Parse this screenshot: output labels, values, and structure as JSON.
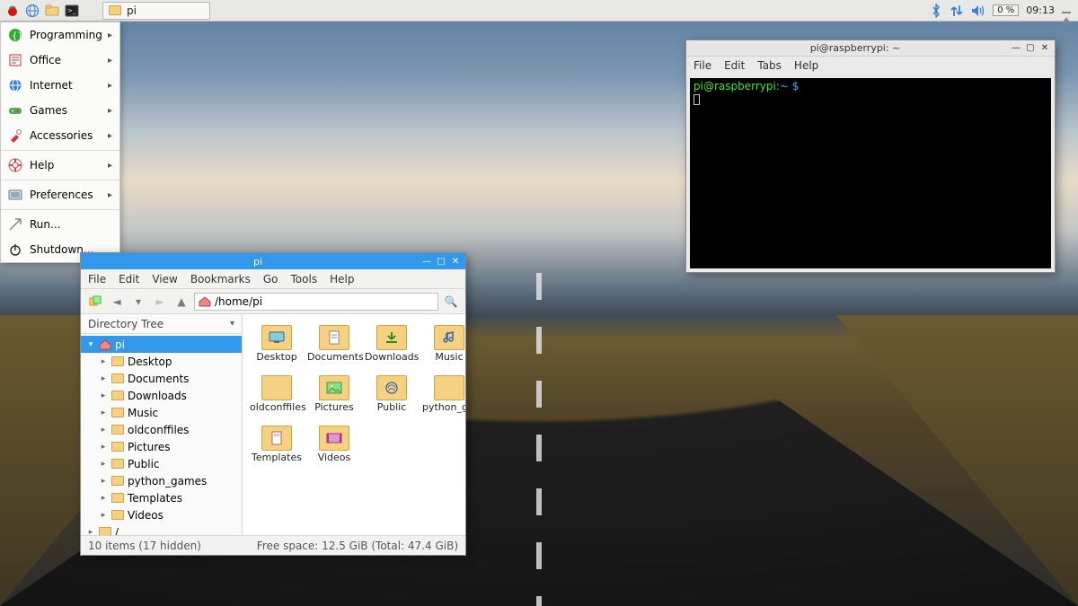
{
  "taskbar": {
    "task_label": "pi",
    "cpu": "0 %",
    "clock": "09:13"
  },
  "appmenu": {
    "items": [
      {
        "label": "Programming",
        "submenu": true
      },
      {
        "label": "Office",
        "submenu": true
      },
      {
        "label": "Internet",
        "submenu": true
      },
      {
        "label": "Games",
        "submenu": true
      },
      {
        "label": "Accessories",
        "submenu": true
      }
    ],
    "help_label": "Help",
    "prefs_label": "Preferences",
    "run_label": "Run...",
    "shutdown_label": "Shutdown..."
  },
  "fm": {
    "title": "pi",
    "menubar": [
      "File",
      "Edit",
      "View",
      "Bookmarks",
      "Go",
      "Tools",
      "Help"
    ],
    "path": "/home/pi",
    "side_header": "Directory Tree",
    "tree": [
      {
        "label": "pi",
        "depth": 0,
        "home": true,
        "selected": true,
        "expanded": true
      },
      {
        "label": "Desktop",
        "depth": 1
      },
      {
        "label": "Documents",
        "depth": 1
      },
      {
        "label": "Downloads",
        "depth": 1
      },
      {
        "label": "Music",
        "depth": 1
      },
      {
        "label": "oldconffiles",
        "depth": 1
      },
      {
        "label": "Pictures",
        "depth": 1
      },
      {
        "label": "Public",
        "depth": 1
      },
      {
        "label": "python_games",
        "depth": 1
      },
      {
        "label": "Templates",
        "depth": 1
      },
      {
        "label": "Videos",
        "depth": 1
      },
      {
        "label": "/",
        "depth": 0,
        "root": true
      }
    ],
    "items": [
      {
        "label": "Desktop",
        "glyph": "desktop"
      },
      {
        "label": "Documents",
        "glyph": "doc"
      },
      {
        "label": "Downloads",
        "glyph": "download"
      },
      {
        "label": "Music",
        "glyph": "music"
      },
      {
        "label": "oldconffiles",
        "glyph": "plain"
      },
      {
        "label": "Pictures",
        "glyph": "picture"
      },
      {
        "label": "Public",
        "glyph": "public"
      },
      {
        "label": "python_games",
        "glyph": "plain"
      },
      {
        "label": "Templates",
        "glyph": "template"
      },
      {
        "label": "Videos",
        "glyph": "video"
      }
    ],
    "status_left": "10 items (17 hidden)",
    "status_right": "Free space: 12.5 GiB (Total: 47.4 GiB)"
  },
  "term": {
    "title": "pi@raspberrypi: ~",
    "menubar": [
      "File",
      "Edit",
      "Tabs",
      "Help"
    ],
    "prompt_user": "pi@raspberrypi",
    "prompt_path": "~",
    "prompt_symbol": "$"
  }
}
